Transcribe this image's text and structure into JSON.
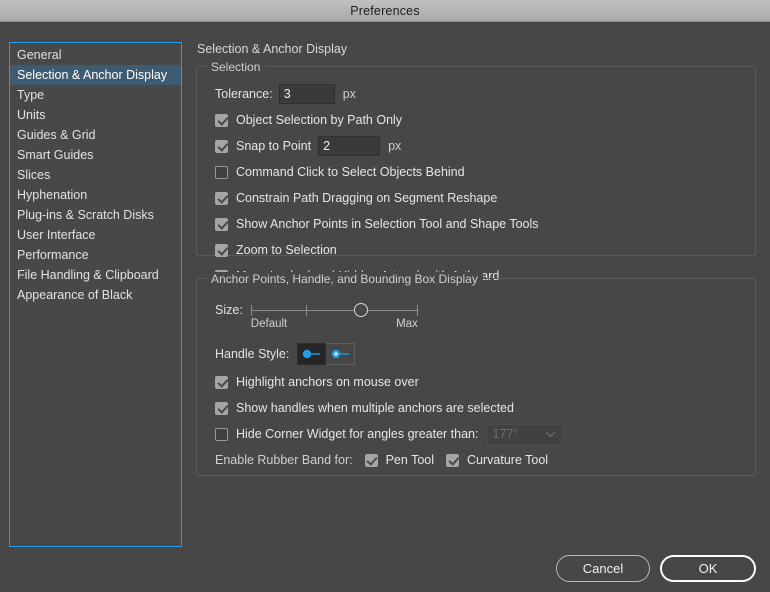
{
  "window": {
    "title": "Preferences"
  },
  "sidebar": {
    "items": [
      {
        "label": "General",
        "selected": false
      },
      {
        "label": "Selection & Anchor Display",
        "selected": true
      },
      {
        "label": "Type",
        "selected": false
      },
      {
        "label": "Units",
        "selected": false
      },
      {
        "label": "Guides & Grid",
        "selected": false
      },
      {
        "label": "Smart Guides",
        "selected": false
      },
      {
        "label": "Slices",
        "selected": false
      },
      {
        "label": "Hyphenation",
        "selected": false
      },
      {
        "label": "Plug-ins & Scratch Disks",
        "selected": false
      },
      {
        "label": "User Interface",
        "selected": false
      },
      {
        "label": "Performance",
        "selected": false
      },
      {
        "label": "File Handling & Clipboard",
        "selected": false
      },
      {
        "label": "Appearance of Black",
        "selected": false
      }
    ]
  },
  "main": {
    "page_title": "Selection & Anchor Display",
    "selection_group": {
      "legend": "Selection",
      "tolerance_label": "Tolerance:",
      "tolerance_value": "3",
      "tolerance_unit": "px",
      "object_selection_label": "Object Selection by Path Only",
      "object_selection_checked": true,
      "snap_to_point_label": "Snap to Point",
      "snap_to_point_checked": true,
      "snap_to_point_value": "2",
      "snap_to_point_unit": "px",
      "command_click_label": "Command Click to Select Objects Behind",
      "command_click_checked": false,
      "constrain_path_label": "Constrain Path Dragging on Segment Reshape",
      "constrain_path_checked": true,
      "show_anchor_points_label": "Show Anchor Points in Selection Tool and Shape Tools",
      "show_anchor_points_checked": true,
      "zoom_to_selection_label": "Zoom to Selection",
      "zoom_to_selection_checked": true,
      "move_locked_label": "Move Locked and Hidden Artwork with Artboard",
      "move_locked_checked": true
    },
    "anchor_group": {
      "legend": "Anchor Points, Handle, and Bounding Box Display",
      "size_label": "Size:",
      "size_min_label": "Default",
      "size_max_label": "Max",
      "size_percent": 66,
      "handle_style_label": "Handle Style:",
      "handle_style_options": [
        {
          "name": "solid-handle",
          "selected": true
        },
        {
          "name": "hollow-handle",
          "selected": false
        }
      ],
      "highlight_anchors_label": "Highlight anchors on mouse over",
      "highlight_anchors_checked": true,
      "show_handles_label": "Show handles when multiple anchors are selected",
      "show_handles_checked": true,
      "hide_corner_widget_label": "Hide Corner Widget for angles greater than:",
      "hide_corner_widget_checked": false,
      "corner_angle_value": "177°",
      "rubber_band_label": "Enable Rubber Band for:",
      "pen_tool_label": "Pen Tool",
      "pen_tool_checked": true,
      "curvature_tool_label": "Curvature Tool",
      "curvature_tool_checked": true
    }
  },
  "footer": {
    "cancel_label": "Cancel",
    "ok_label": "OK"
  },
  "colors": {
    "window_bg": "#474747",
    "titlebar_bg": "#b4b4b4",
    "sidebar_focus_border": "#1e9fe8",
    "sidebar_selected_bg": "#3f5b72",
    "handle_accent": "#1e9fe8",
    "text_primary": "#e6e6e6"
  }
}
